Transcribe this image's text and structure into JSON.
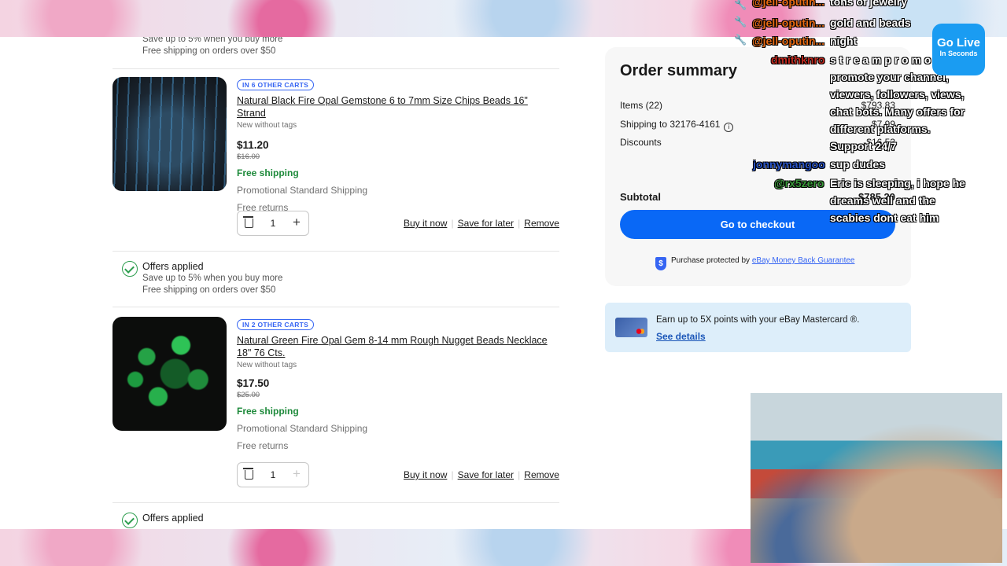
{
  "cart": {
    "offers_top": {
      "line1": "Save up to 5% when you buy more",
      "line2": "Free shipping on orders over $50"
    },
    "items": [
      {
        "tag": "IN 6 OTHER CARTS",
        "title": "Natural Black Fire Opal Gemstone 6 to 7mm Size Chips Beads 16\" Strand",
        "condition": "New without tags",
        "price": "$11.20",
        "original_price": "$16.00",
        "free_shipping": "Free shipping",
        "shipping_method": "Promotional Standard Shipping",
        "returns": "Free returns",
        "qty": "1",
        "buy_now": "Buy it now",
        "save_later": "Save for later",
        "remove": "Remove"
      },
      {
        "tag": "IN 2 OTHER CARTS",
        "title": "Natural Green Fire Opal Gem 8-14 mm Rough Nugget Beads Necklace 18\" 76 Cts.",
        "condition": "New without tags",
        "price": "$17.50",
        "original_price": "$25.00",
        "free_shipping": "Free shipping",
        "shipping_method": "Promotional Standard Shipping",
        "returns": "Free returns",
        "qty": "1",
        "buy_now": "Buy it now",
        "save_later": "Save for later",
        "remove": "Remove"
      }
    ],
    "offers_mid": {
      "title": "Offers applied",
      "line1": "Save up to 5% when you buy more",
      "line2": "Free shipping on orders over $50"
    },
    "offers_bottom": {
      "title": "Offers applied"
    }
  },
  "summary": {
    "title": "Order summary",
    "items_label": "Items (22)",
    "items_amount": "$793.83",
    "shipping_label": "Shipping to 32176-4161",
    "shipping_amount": "$7.99",
    "discounts_label": "Discounts",
    "discounts_amount": "-$16.53",
    "subtotal_label": "Subtotal",
    "subtotal_amount": "$785.29",
    "checkout": "Go to checkout",
    "protected_text": "Purchase protected by",
    "guarantee_link": "eBay Money Back Guarantee"
  },
  "promo": {
    "text": "Earn up to 5X points with your eBay Mastercard ®.",
    "link": "See details"
  },
  "chat": {
    "messages": [
      {
        "user": "@jell-oputin...",
        "msg": "tons of jewelry"
      },
      {
        "user": "@jell-oputin...",
        "msg": "gold and beads"
      },
      {
        "user": "@jell-oputin...",
        "msg": "night"
      },
      {
        "user": "dmithknro",
        "msg": "s t r e a m p r o m o t"
      },
      {
        "user": "",
        "msg": "promote your channel,"
      },
      {
        "user": "",
        "msg": "viewers, followers, views,"
      },
      {
        "user": "",
        "msg": "chat bots. Many offers for"
      },
      {
        "user": "",
        "msg": "different platforms."
      },
      {
        "user": "",
        "msg": "Support 24/7"
      },
      {
        "user": "jonnymangoo",
        "msg": "sup dudes"
      },
      {
        "user": "@rx5zero",
        "msg": "Eric is sleeping, i hope he"
      },
      {
        "user": "",
        "msg": "dreams well and the"
      },
      {
        "user": "",
        "msg": "scabies dont eat him"
      }
    ],
    "user_colors": {
      "jell": "#e86a13",
      "dmithknro": "#c0281e",
      "jonnymangoo": "#2a55c8",
      "rx5zero": "#3a9a3a"
    }
  },
  "golive": {
    "line1": "Go Live",
    "line2": "In Seconds"
  },
  "colors": {
    "accent": "#0968f6",
    "free_shipping": "#1e8a3b",
    "tag": "#3665f3"
  }
}
